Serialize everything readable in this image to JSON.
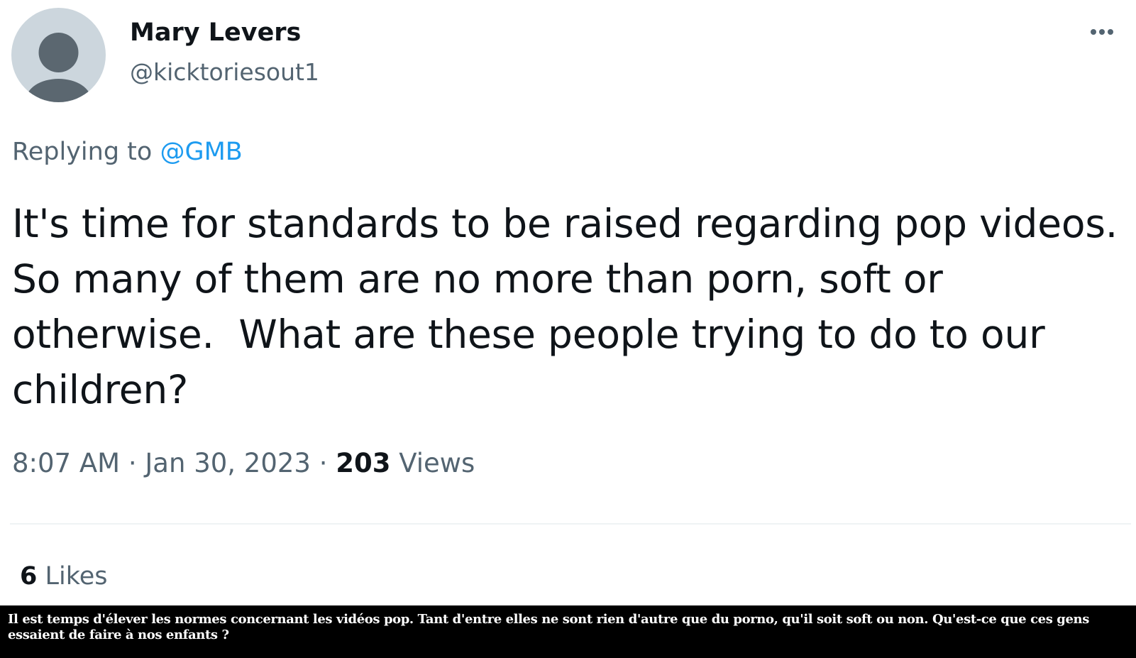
{
  "tweet": {
    "author": {
      "display_name": "Mary Levers",
      "handle": "@kicktoriesout1",
      "avatar": "default-profile-icon"
    },
    "more_icon": "more-options-icon",
    "reply": {
      "prefix": "Replying to",
      "mention": "@GMB"
    },
    "text": "It's time for standards to be raised regarding pop videos.  So many of them are no more than porn, soft or otherwise.  What are these people trying to do to our children?",
    "meta": {
      "time": "8:07 AM",
      "date": "Jan 30, 2023",
      "separator": "·",
      "views_count": "203",
      "views_label": "Views"
    },
    "likes": {
      "count": "6",
      "label": "Likes"
    }
  },
  "caption": {
    "text": "Il est temps d'élever les normes concernant les vidéos pop. Tant d'entre elles ne sont rien d'autre que du porno, qu'il soit soft ou non. Qu'est-ce que ces gens essaient de faire à nos enfants ?"
  },
  "colors": {
    "text_primary": "#0f1419",
    "text_secondary": "#536471",
    "link": "#1d9bf0",
    "avatar_bg": "#ccd6dd",
    "avatar_figure": "#5b6770",
    "caption_bg": "#000000",
    "caption_text": "#ffffff"
  }
}
